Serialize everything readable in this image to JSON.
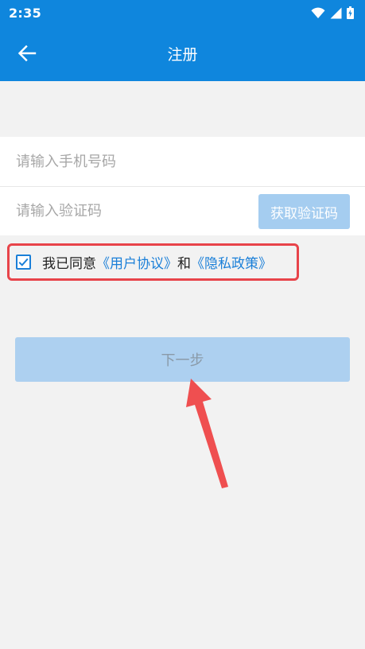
{
  "status_bar": {
    "time": "2:35",
    "icons": [
      "wifi-icon",
      "signal-icon",
      "battery-icon"
    ]
  },
  "app_bar": {
    "back_icon": "arrow-left-icon",
    "title": "注册"
  },
  "form": {
    "phone_placeholder": "请输入手机号码",
    "phone_value": "",
    "code_placeholder": "请输入验证码",
    "code_value": "",
    "get_code_label": "获取验证码"
  },
  "agreement": {
    "checked": true,
    "prefix": "我已同意",
    "user_agreement": "《用户协议》",
    "and": "和",
    "privacy_policy": "《隐私政策》"
  },
  "next_label": "下一步",
  "colors": {
    "primary": "#0f86dd",
    "link": "#1a7fd8",
    "highlight_red": "#e8444a",
    "disabled_button": "#add0f0"
  }
}
